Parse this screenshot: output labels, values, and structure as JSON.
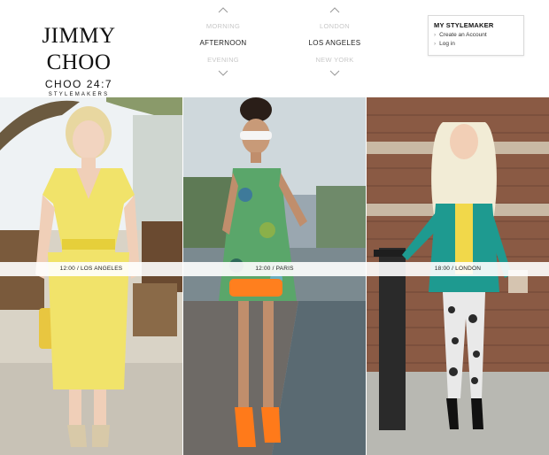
{
  "brand": {
    "name": "JIMMY CHOO",
    "campaign": "CHOO 24:7",
    "tagline": "STYLEMAKERS"
  },
  "time_picker": {
    "options": [
      "MORNING",
      "AFTERNOON",
      "EVENING"
    ],
    "selected": "AFTERNOON"
  },
  "city_picker": {
    "options": [
      "LONDON",
      "LOS ANGELES",
      "NEW YORK"
    ],
    "selected": "LOS ANGELES"
  },
  "stylemaker_panel": {
    "title": "MY STYLEMAKER",
    "links": [
      "Create an Account",
      "Log in"
    ]
  },
  "tiles": [
    {
      "caption": "12:00 / LOS ANGELES"
    },
    {
      "caption": "12:00 / PARIS"
    },
    {
      "caption": "18:00 / LONDON"
    }
  ],
  "colors": {
    "outfit_yellow": "#f1e36a",
    "dress_green": "#5aa66a",
    "jacket_teal": "#1e9a90",
    "brick": "#8a5a44"
  }
}
